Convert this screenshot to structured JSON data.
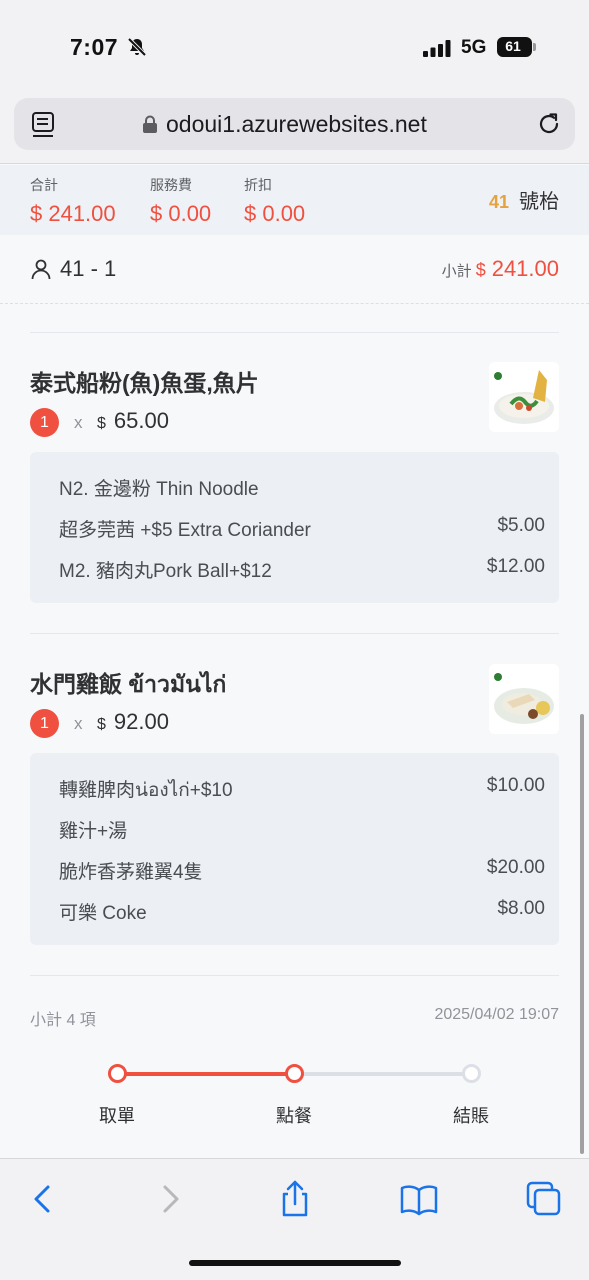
{
  "status_bar": {
    "time": "7:07",
    "network": "5G",
    "battery": "61"
  },
  "browser": {
    "url": "odoui1.azurewebsites.net"
  },
  "summary": {
    "items": [
      {
        "label": "合計",
        "value": "$ 241.00"
      },
      {
        "label": "服務費",
        "value": "$ 0.00"
      },
      {
        "label": "折扣",
        "value": "$ 0.00"
      }
    ],
    "table_number": "41",
    "table_suffix": "號枱"
  },
  "order": {
    "guest_text": "41 - 1",
    "subtotal_label": "小計",
    "subtotal_currency": "$",
    "subtotal_value": "241.00"
  },
  "items": [
    {
      "name": "泰式船粉(魚)魚蛋,魚片",
      "qty": "1",
      "x": "x",
      "currency": "$",
      "price": "65.00",
      "options": [
        {
          "label": "N2. 金邊粉 Thin Noodle",
          "price": ""
        },
        {
          "label": "超多莞茜 +$5 Extra Coriander",
          "price": "$5.00"
        },
        {
          "label": "M2. 豬肉丸Pork Ball+$12",
          "price": "$12.00"
        }
      ]
    },
    {
      "name": "水門雞飯 ข้าวมันไก่",
      "qty": "1",
      "x": "x",
      "currency": "$",
      "price": "92.00",
      "options": [
        {
          "label": "轉雞脾肉น่องไก่+$10",
          "price": "$10.00"
        },
        {
          "label": "雞汁+湯",
          "price": ""
        },
        {
          "label": "脆炸香茅雞翼4隻",
          "price": "$20.00"
        },
        {
          "label": "可樂 Coke",
          "price": "$8.00"
        }
      ]
    }
  ],
  "footer": {
    "count_text": "小計 4 項",
    "datetime": "2025/04/02 19:07"
  },
  "steps": [
    {
      "label": "取單",
      "state": "done"
    },
    {
      "label": "點餐",
      "state": "current"
    },
    {
      "label": "結賬",
      "state": "pending"
    }
  ],
  "colors": {
    "accent": "#f0503f",
    "table_number": "#e6a23c",
    "ios_blue": "#1a73e8"
  },
  "toolbar_icons": [
    "back-icon",
    "forward-icon",
    "share-icon",
    "bookmarks-icon",
    "tabs-icon"
  ]
}
